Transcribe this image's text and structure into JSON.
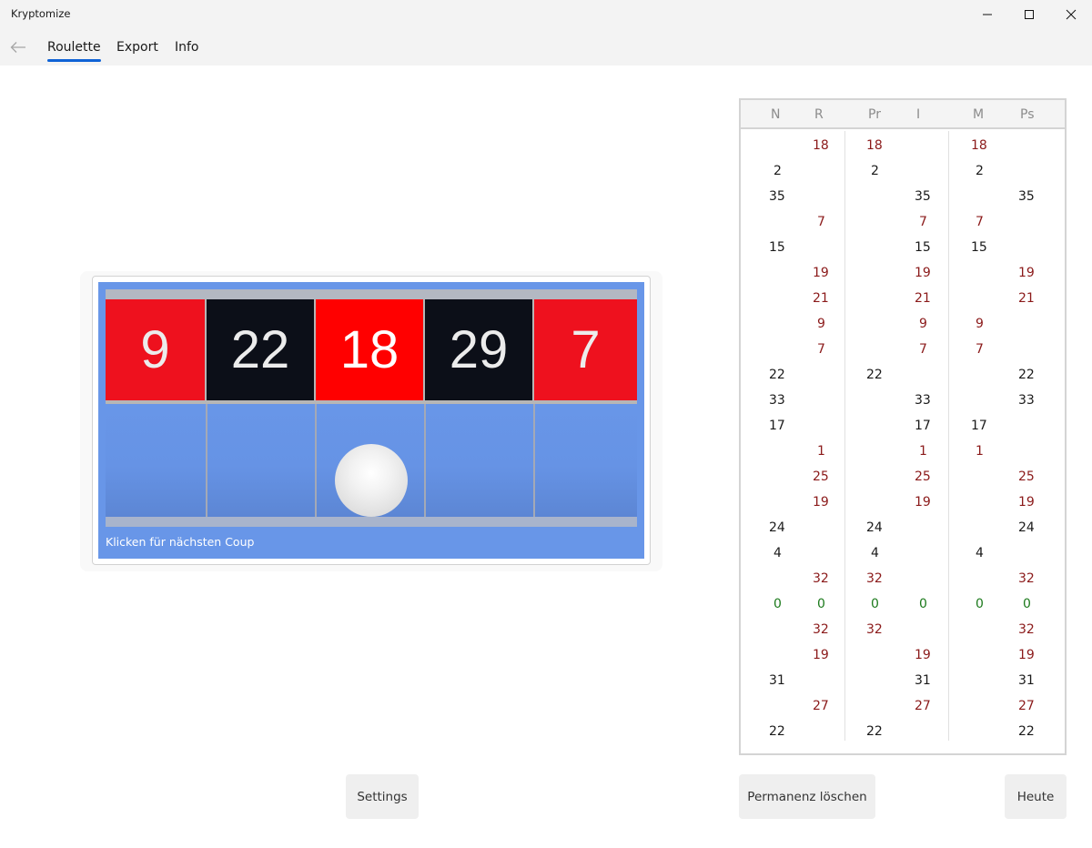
{
  "window": {
    "title": "Kryptomize",
    "controls": {
      "minimize": "minimize-icon",
      "maximize": "maximize-icon",
      "close": "close-icon"
    }
  },
  "nav": {
    "back_icon": "arrow-left-icon",
    "tabs": [
      {
        "label": "Roulette",
        "active": true
      },
      {
        "label": "Export",
        "active": false
      },
      {
        "label": "Info",
        "active": false
      }
    ]
  },
  "board": {
    "numbers": [
      {
        "value": "9",
        "color": "#ee111e"
      },
      {
        "value": "22",
        "color": "#0c0f18"
      },
      {
        "value": "18",
        "color": "#ff0000"
      },
      {
        "value": "29",
        "color": "#0c0f18"
      },
      {
        "value": "7",
        "color": "#ee111e"
      }
    ],
    "ball_lane": 3,
    "hint": "Klicken für nächsten Coup"
  },
  "permanenz": {
    "headers": [
      "N",
      "R",
      "Pr",
      "I",
      "M",
      "Ps"
    ],
    "rows": [
      {
        "number": "18",
        "color": "red",
        "cols": [
          "R",
          "Pr",
          "M"
        ]
      },
      {
        "number": "2",
        "color": "black",
        "cols": [
          "N",
          "Pr",
          "M"
        ]
      },
      {
        "number": "35",
        "color": "black",
        "cols": [
          "N",
          "I",
          "Ps"
        ]
      },
      {
        "number": "7",
        "color": "red",
        "cols": [
          "R",
          "I",
          "M"
        ]
      },
      {
        "number": "15",
        "color": "black",
        "cols": [
          "N",
          "I",
          "M"
        ]
      },
      {
        "number": "19",
        "color": "red",
        "cols": [
          "R",
          "I",
          "Ps"
        ]
      },
      {
        "number": "21",
        "color": "red",
        "cols": [
          "R",
          "I",
          "Ps"
        ]
      },
      {
        "number": "9",
        "color": "red",
        "cols": [
          "R",
          "I",
          "M"
        ]
      },
      {
        "number": "7",
        "color": "red",
        "cols": [
          "R",
          "I",
          "M"
        ]
      },
      {
        "number": "22",
        "color": "black",
        "cols": [
          "N",
          "Pr",
          "Ps"
        ]
      },
      {
        "number": "33",
        "color": "black",
        "cols": [
          "N",
          "I",
          "Ps"
        ]
      },
      {
        "number": "17",
        "color": "black",
        "cols": [
          "N",
          "I",
          "M"
        ]
      },
      {
        "number": "1",
        "color": "red",
        "cols": [
          "R",
          "I",
          "M"
        ]
      },
      {
        "number": "25",
        "color": "red",
        "cols": [
          "R",
          "I",
          "Ps"
        ]
      },
      {
        "number": "19",
        "color": "red",
        "cols": [
          "R",
          "I",
          "Ps"
        ]
      },
      {
        "number": "24",
        "color": "black",
        "cols": [
          "N",
          "Pr",
          "Ps"
        ]
      },
      {
        "number": "4",
        "color": "black",
        "cols": [
          "N",
          "Pr",
          "M"
        ]
      },
      {
        "number": "32",
        "color": "red",
        "cols": [
          "R",
          "Pr",
          "Ps"
        ]
      },
      {
        "number": "0",
        "color": "green",
        "cols": [
          "N",
          "R",
          "Pr",
          "I",
          "M",
          "Ps"
        ]
      },
      {
        "number": "32",
        "color": "red",
        "cols": [
          "R",
          "Pr",
          "Ps"
        ]
      },
      {
        "number": "19",
        "color": "red",
        "cols": [
          "R",
          "I",
          "Ps"
        ]
      },
      {
        "number": "31",
        "color": "black",
        "cols": [
          "N",
          "I",
          "Ps"
        ]
      },
      {
        "number": "27",
        "color": "red",
        "cols": [
          "R",
          "I",
          "Ps"
        ]
      },
      {
        "number": "22",
        "color": "black",
        "cols": [
          "N",
          "Pr",
          "Ps"
        ]
      }
    ]
  },
  "buttons": {
    "settings": "Settings",
    "clear": "Permanenz löschen",
    "today": "Heute"
  }
}
